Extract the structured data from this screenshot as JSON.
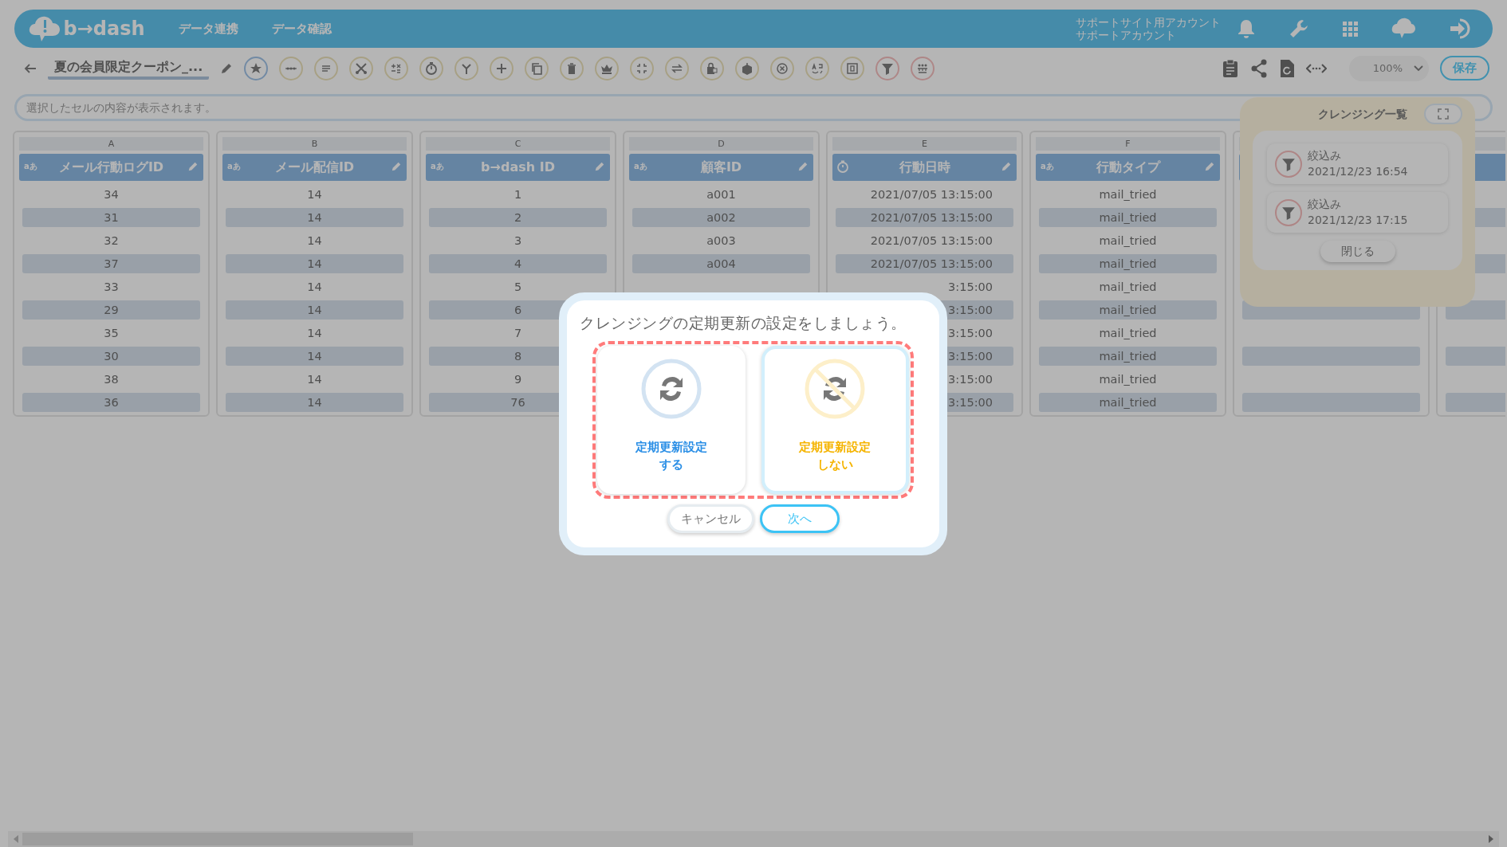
{
  "header": {
    "logo": "b→dash",
    "nav": [
      "データ連携",
      "データ確認"
    ],
    "account": {
      "site": "サポートサイト用アカウント",
      "name": "サポートアカウント"
    }
  },
  "toolbar": {
    "title": "夏の会員限定クーポン_...",
    "zoom": "100%",
    "save": "保存"
  },
  "formula_bar": {
    "placeholder": "選択したセルの内容が表示されます。"
  },
  "table": {
    "columns": [
      {
        "letter": "A",
        "name": "メール行動ログID",
        "kind": "text",
        "badge": "aあ"
      },
      {
        "letter": "B",
        "name": "メール配信ID",
        "kind": "text",
        "badge": "aあ"
      },
      {
        "letter": "C",
        "name": "b→dash ID",
        "kind": "text",
        "badge": "aあ"
      },
      {
        "letter": "D",
        "name": "顧客ID",
        "kind": "text",
        "badge": "aあ"
      },
      {
        "letter": "E",
        "name": "行動日時",
        "kind": "datetime"
      },
      {
        "letter": "F",
        "name": "行動タイプ",
        "kind": "text",
        "badge": "aあ"
      },
      {
        "kind": "blank"
      },
      {
        "kind": "blank"
      }
    ],
    "rows": [
      [
        "34",
        "14",
        "1",
        "a001",
        "2021/07/05 13:15:00",
        "mail_tried"
      ],
      [
        "31",
        "14",
        "2",
        "a002",
        "2021/07/05 13:15:00",
        "mail_tried"
      ],
      [
        "32",
        "14",
        "3",
        "a003",
        "2021/07/05 13:15:00",
        "mail_tried"
      ],
      [
        "37",
        "14",
        "4",
        "a004",
        "2021/07/05 13:15:00",
        "mail_tried"
      ],
      [
        "33",
        "14",
        "5",
        "",
        "3:15:00",
        "mail_tried"
      ],
      [
        "29",
        "14",
        "6",
        "",
        "3:15:00",
        "mail_tried"
      ],
      [
        "35",
        "14",
        "7",
        "",
        "3:15:00",
        "mail_tried"
      ],
      [
        "30",
        "14",
        "8",
        "",
        "3:15:00",
        "mail_tried"
      ],
      [
        "38",
        "14",
        "9",
        "",
        "3:15:00",
        "mail_tried"
      ],
      [
        "36",
        "14",
        "76",
        "",
        "3:15:00",
        "mail_tried"
      ]
    ]
  },
  "cleansing_panel": {
    "title": "クレンジング一覧",
    "items": [
      {
        "label": "絞込み",
        "time": "2021/12/23 16:54"
      },
      {
        "label": "絞込み",
        "time": "2021/12/23 17:15"
      }
    ],
    "close": "閉じる"
  },
  "dialog": {
    "title": "クレンジングの定期更新の設定をしましょう。",
    "options_highlighted": true,
    "options": [
      {
        "kind": "on",
        "label_lines": [
          "定期更新設定",
          "する"
        ],
        "selected": false
      },
      {
        "kind": "off",
        "label_lines": [
          "定期更新設定",
          "しない"
        ],
        "selected": true
      }
    ],
    "buttons": [
      {
        "kind": "cancel",
        "label": "キャンセル"
      },
      {
        "kind": "next",
        "label": "次へ"
      }
    ]
  }
}
